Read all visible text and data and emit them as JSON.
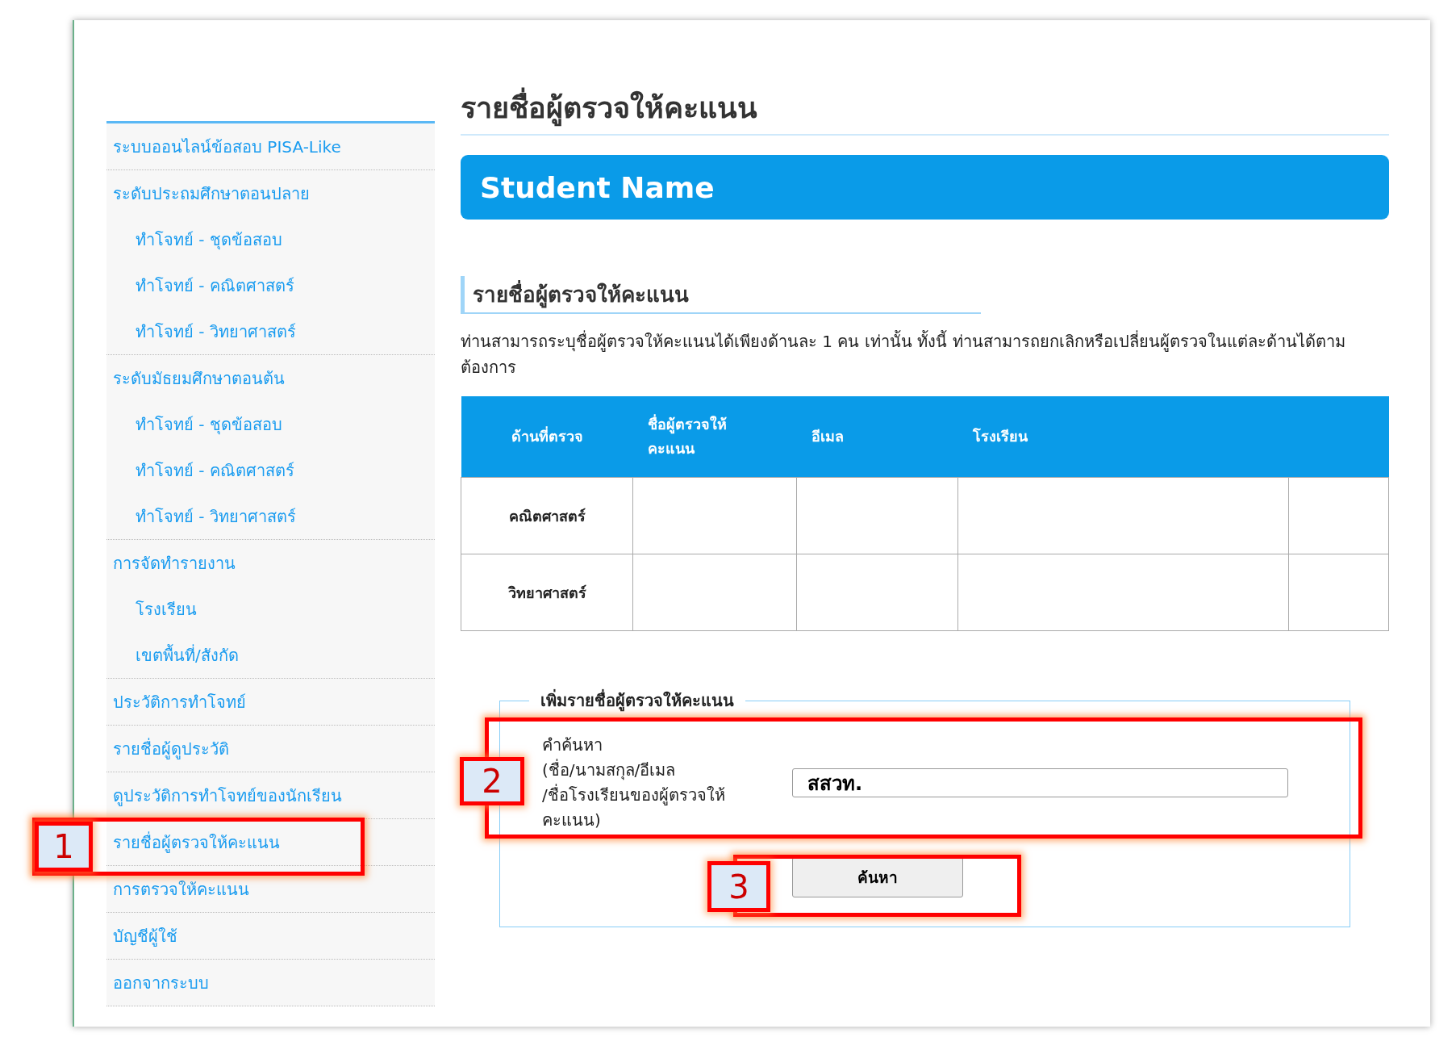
{
  "sidebar": {
    "items": [
      {
        "label": "ระบบออนไลน์ข้อสอบ PISA-Like"
      },
      {
        "label": "ระดับประถมศึกษาตอนปลาย",
        "children": [
          {
            "label": "ทำโจทย์ - ชุดข้อสอบ"
          },
          {
            "label": "ทำโจทย์ - คณิตศาสตร์"
          },
          {
            "label": "ทำโจทย์ - วิทยาศาสตร์"
          }
        ]
      },
      {
        "label": "ระดับมัธยมศึกษาตอนต้น",
        "children": [
          {
            "label": "ทำโจทย์ - ชุดข้อสอบ"
          },
          {
            "label": "ทำโจทย์ - คณิตศาสตร์"
          },
          {
            "label": "ทำโจทย์ - วิทยาศาสตร์"
          }
        ]
      },
      {
        "label": "การจัดทำรายงาน",
        "children": [
          {
            "label": "โรงเรียน"
          },
          {
            "label": "เขตพื้นที่/สังกัด"
          }
        ]
      },
      {
        "label": "ประวัติการทำโจทย์"
      },
      {
        "label": "รายชื่อผู้ดูประวัติ"
      },
      {
        "label": "ดูประวัติการทำโจทย์ของนักเรียน"
      },
      {
        "label": "รายชื่อผู้ตรวจให้คะแนน"
      },
      {
        "label": "การตรวจให้คะแนน"
      },
      {
        "label": "บัญชีผู้ใช้"
      },
      {
        "label": "ออกจากระบบ"
      }
    ]
  },
  "page_title": "รายชื่อผู้ตรวจให้คะแนน",
  "banner": "Student Name",
  "section_title": "รายชื่อผู้ตรวจให้คะแนน",
  "description": "ท่านสามารถระบุชื่อผู้ตรวจให้คะแนนได้เพียงด้านละ 1 คน เท่านั้น ทั้งนี้ ท่านสามารถยกเลิกหรือเปลี่ยนผู้ตรวจในแต่ละด้านได้ตามต้องการ",
  "table": {
    "columns": [
      "ด้านที่ตรวจ",
      "ชื่อผู้ตรวจให้คะแนน",
      "อีเมล",
      "โรงเรียน"
    ],
    "rows": [
      {
        "subject": "คณิตศาสตร์"
      },
      {
        "subject": "วิทยาศาสตร์"
      }
    ]
  },
  "form": {
    "legend": "เพิ่มรายชื่อผู้ตรวจให้คะแนน",
    "label": "คำค้นหา\n(ชื่อ/นามสกุล/อีเมล\n/ชื่อโรงเรียนของผู้ตรวจให้\nคะแนน)",
    "value": "สสวท.",
    "button": "ค้นหา"
  },
  "callouts": [
    {
      "number": "1"
    },
    {
      "number": "2"
    },
    {
      "number": "3"
    }
  ]
}
